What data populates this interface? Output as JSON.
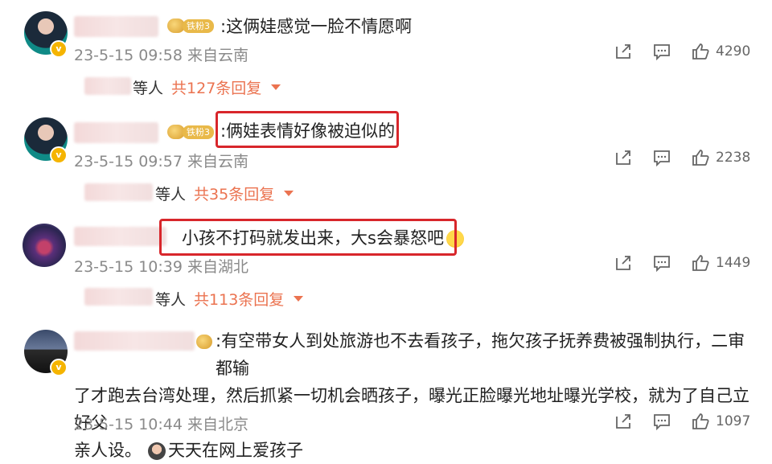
{
  "comments": [
    {
      "badge": "铁粉3",
      "text": ":这俩娃感觉一脸不情愿啊",
      "meta": "23-5-15 09:58 来自云南",
      "likes": "4290",
      "reply_who": "等人",
      "reply_count": "共127条回复"
    },
    {
      "badge": "铁粉3",
      "text": ":俩娃表情好像被迫似的",
      "meta": "23-5-15 09:57 来自云南",
      "likes": "2238",
      "reply_who": "等人",
      "reply_count": "共35条回复"
    },
    {
      "text": "小孩不打码就发出来，大s会暴怒吧",
      "meta": "23-5-15 10:39 来自湖北",
      "likes": "1449",
      "reply_who": "等人",
      "reply_count": "共113条回复"
    },
    {
      "text_line1": ":有空带女人到处旅游也不去看孩子，拖欠孩子抚养费被强制执行，二审都输",
      "text_line2": "了才跑去台湾处理，然后抓紧一切机会晒孩子，曝光正脸曝光地址曝光学校，就为了自己立好父",
      "text_line3": "亲人设。",
      "text_link": "天天在网上爱孩子",
      "meta": "23-5-15 10:44 来自北京",
      "likes": "1097"
    }
  ],
  "colors": {
    "highlight": "#d8262b",
    "reply_link": "#eb7350",
    "meta_gray": "#8a8a8a"
  }
}
